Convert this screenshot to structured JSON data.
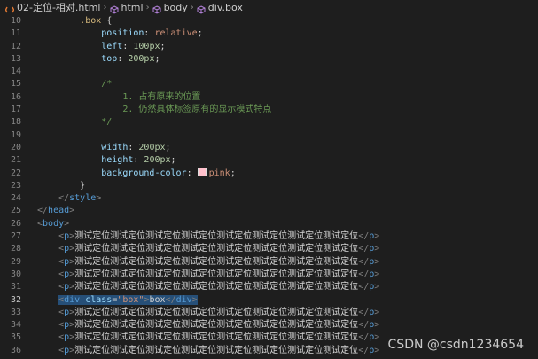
{
  "breadcrumb": {
    "file": "02-定位-相对.html",
    "html": "html",
    "body": "body",
    "element": "div.box"
  },
  "icons": {
    "file": "html-file-icon",
    "element": "cube-icon",
    "separator": "chevron-right-icon"
  },
  "colors": {
    "background": "#1e1e1e",
    "selection": "#264f78",
    "swatch": "#ffc0cb"
  },
  "editor": {
    "active_line": 32,
    "lines": [
      {
        "n": "10",
        "tokens": [
          {
            "t": "        "
          },
          {
            "c": "sel",
            "t": ".box"
          },
          {
            "t": " {"
          }
        ]
      },
      {
        "n": "11",
        "tokens": [
          {
            "t": "            "
          },
          {
            "c": "prop",
            "t": "position"
          },
          {
            "t": ": "
          },
          {
            "c": "val",
            "t": "relative"
          },
          {
            "t": ";"
          }
        ]
      },
      {
        "n": "12",
        "tokens": [
          {
            "t": "            "
          },
          {
            "c": "prop",
            "t": "left"
          },
          {
            "t": ": "
          },
          {
            "c": "num",
            "t": "100px"
          },
          {
            "t": ";"
          }
        ]
      },
      {
        "n": "13",
        "tokens": [
          {
            "t": "            "
          },
          {
            "c": "prop",
            "t": "top"
          },
          {
            "t": ": "
          },
          {
            "c": "num",
            "t": "200px"
          },
          {
            "t": ";"
          }
        ]
      },
      {
        "n": "14",
        "tokens": []
      },
      {
        "n": "15",
        "tokens": [
          {
            "t": "            "
          },
          {
            "c": "com",
            "t": "/*"
          }
        ]
      },
      {
        "n": "16",
        "tokens": [
          {
            "t": "                "
          },
          {
            "c": "com",
            "t": "1. 占有原来的位置"
          }
        ]
      },
      {
        "n": "17",
        "tokens": [
          {
            "t": "                "
          },
          {
            "c": "com",
            "t": "2. 仍然具体标签原有的显示模式特点"
          }
        ]
      },
      {
        "n": "18",
        "tokens": [
          {
            "t": "            "
          },
          {
            "c": "com",
            "t": "*/"
          }
        ]
      },
      {
        "n": "19",
        "tokens": []
      },
      {
        "n": "20",
        "tokens": [
          {
            "t": "            "
          },
          {
            "c": "prop",
            "t": "width"
          },
          {
            "t": ": "
          },
          {
            "c": "num",
            "t": "200px"
          },
          {
            "t": ";"
          }
        ]
      },
      {
        "n": "21",
        "tokens": [
          {
            "t": "            "
          },
          {
            "c": "prop",
            "t": "height"
          },
          {
            "t": ": "
          },
          {
            "c": "num",
            "t": "200px"
          },
          {
            "t": ";"
          }
        ]
      },
      {
        "n": "22",
        "tokens": [
          {
            "t": "            "
          },
          {
            "c": "prop",
            "t": "background-color"
          },
          {
            "t": ": "
          },
          {
            "c": "swatch",
            "t": ""
          },
          {
            "c": "val",
            "t": "pink"
          },
          {
            "t": ";"
          }
        ]
      },
      {
        "n": "23",
        "tokens": [
          {
            "t": "        }"
          }
        ]
      },
      {
        "n": "24",
        "tokens": [
          {
            "t": "    "
          },
          {
            "c": "bracket",
            "t": "</"
          },
          {
            "c": "tag",
            "t": "style"
          },
          {
            "c": "bracket",
            "t": ">"
          }
        ]
      },
      {
        "n": "25",
        "tokens": [
          {
            "c": "bracket",
            "t": "</"
          },
          {
            "c": "tag",
            "t": "head"
          },
          {
            "c": "bracket",
            "t": ">"
          }
        ]
      },
      {
        "n": "26",
        "tokens": [
          {
            "c": "bracket",
            "t": "<"
          },
          {
            "c": "tag",
            "t": "body"
          },
          {
            "c": "bracket",
            "t": ">"
          }
        ]
      },
      {
        "n": "27",
        "tokens": [
          {
            "t": "    "
          },
          {
            "c": "bracket",
            "t": "<"
          },
          {
            "c": "tag",
            "t": "p"
          },
          {
            "c": "bracket",
            "t": ">"
          },
          {
            "c": "text",
            "t": "测试定位测试定位测试定位测试定位测试定位测试定位测试定位测试定位"
          },
          {
            "c": "bracket",
            "t": "</"
          },
          {
            "c": "tag",
            "t": "p"
          },
          {
            "c": "bracket",
            "t": ">"
          }
        ]
      },
      {
        "n": "28",
        "tokens": [
          {
            "t": "    "
          },
          {
            "c": "bracket",
            "t": "<"
          },
          {
            "c": "tag",
            "t": "p"
          },
          {
            "c": "bracket",
            "t": ">"
          },
          {
            "c": "text",
            "t": "测试定位测试定位测试定位测试定位测试定位测试定位测试定位测试定位"
          },
          {
            "c": "bracket",
            "t": "</"
          },
          {
            "c": "tag",
            "t": "p"
          },
          {
            "c": "bracket",
            "t": ">"
          }
        ]
      },
      {
        "n": "29",
        "tokens": [
          {
            "t": "    "
          },
          {
            "c": "bracket",
            "t": "<"
          },
          {
            "c": "tag",
            "t": "p"
          },
          {
            "c": "bracket",
            "t": ">"
          },
          {
            "c": "text",
            "t": "测试定位测试定位测试定位测试定位测试定位测试定位测试定位测试定位"
          },
          {
            "c": "bracket",
            "t": "</"
          },
          {
            "c": "tag",
            "t": "p"
          },
          {
            "c": "bracket",
            "t": ">"
          }
        ]
      },
      {
        "n": "30",
        "tokens": [
          {
            "t": "    "
          },
          {
            "c": "bracket",
            "t": "<"
          },
          {
            "c": "tag",
            "t": "p"
          },
          {
            "c": "bracket",
            "t": ">"
          },
          {
            "c": "text",
            "t": "测试定位测试定位测试定位测试定位测试定位测试定位测试定位测试定位"
          },
          {
            "c": "bracket",
            "t": "</"
          },
          {
            "c": "tag",
            "t": "p"
          },
          {
            "c": "bracket",
            "t": ">"
          }
        ]
      },
      {
        "n": "31",
        "tokens": [
          {
            "t": "    "
          },
          {
            "c": "bracket",
            "t": "<"
          },
          {
            "c": "tag",
            "t": "p"
          },
          {
            "c": "bracket",
            "t": ">"
          },
          {
            "c": "text",
            "t": "测试定位测试定位测试定位测试定位测试定位测试定位测试定位测试定位"
          },
          {
            "c": "bracket",
            "t": "</"
          },
          {
            "c": "tag",
            "t": "p"
          },
          {
            "c": "bracket",
            "t": ">"
          }
        ]
      },
      {
        "n": "32",
        "tokens": [
          {
            "t": "    "
          },
          {
            "c": "bracket",
            "t": "<",
            "s": true
          },
          {
            "c": "tag",
            "t": "div",
            "s": true
          },
          {
            "c": "attr",
            "t": " class",
            "s": true
          },
          {
            "t": "=",
            "s": true
          },
          {
            "c": "str",
            "t": "\"box\"",
            "s": true
          },
          {
            "c": "bracket",
            "t": ">",
            "s": true
          },
          {
            "c": "text",
            "t": "box",
            "s": true
          },
          {
            "c": "bracket",
            "t": "</",
            "s": true
          },
          {
            "c": "tag",
            "t": "div",
            "s": true
          },
          {
            "c": "bracket",
            "t": ">",
            "s": true
          }
        ]
      },
      {
        "n": "33",
        "tokens": [
          {
            "t": "    "
          },
          {
            "c": "bracket",
            "t": "<"
          },
          {
            "c": "tag",
            "t": "p"
          },
          {
            "c": "bracket",
            "t": ">"
          },
          {
            "c": "text",
            "t": "测试定位测试定位测试定位测试定位测试定位测试定位测试定位测试定位"
          },
          {
            "c": "bracket",
            "t": "</"
          },
          {
            "c": "tag",
            "t": "p"
          },
          {
            "c": "bracket",
            "t": ">"
          }
        ]
      },
      {
        "n": "34",
        "tokens": [
          {
            "t": "    "
          },
          {
            "c": "bracket",
            "t": "<"
          },
          {
            "c": "tag",
            "t": "p"
          },
          {
            "c": "bracket",
            "t": ">"
          },
          {
            "c": "text",
            "t": "测试定位测试定位测试定位测试定位测试定位测试定位测试定位测试定位"
          },
          {
            "c": "bracket",
            "t": "</"
          },
          {
            "c": "tag",
            "t": "p"
          },
          {
            "c": "bracket",
            "t": ">"
          }
        ]
      },
      {
        "n": "35",
        "tokens": [
          {
            "t": "    "
          },
          {
            "c": "bracket",
            "t": "<"
          },
          {
            "c": "tag",
            "t": "p"
          },
          {
            "c": "bracket",
            "t": ">"
          },
          {
            "c": "text",
            "t": "测试定位测试定位测试定位测试定位测试定位测试定位测试定位测试定位"
          },
          {
            "c": "bracket",
            "t": "</"
          },
          {
            "c": "tag",
            "t": "p"
          },
          {
            "c": "bracket",
            "t": ">"
          }
        ]
      },
      {
        "n": "36",
        "tokens": [
          {
            "t": "    "
          },
          {
            "c": "bracket",
            "t": "<"
          },
          {
            "c": "tag",
            "t": "p"
          },
          {
            "c": "bracket",
            "t": ">"
          },
          {
            "c": "text",
            "t": "测试定位测试定位测试定位测试定位测试定位测试定位测试定位测试定位"
          },
          {
            "c": "bracket",
            "t": "</"
          },
          {
            "c": "tag",
            "t": "p"
          },
          {
            "c": "bracket",
            "t": ">"
          }
        ]
      }
    ]
  },
  "watermark": "CSDN @csdn1234654"
}
